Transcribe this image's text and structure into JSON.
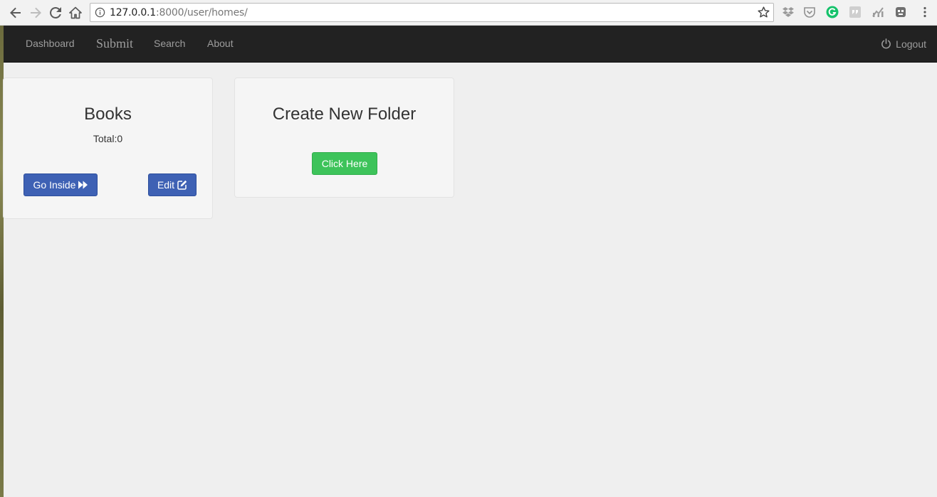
{
  "browser": {
    "url_host": "127.0.0.1",
    "url_rest": ":8000/user/homes/"
  },
  "navbar": {
    "items": [
      {
        "label": "Dashboard"
      },
      {
        "label": "Submit"
      },
      {
        "label": "Search"
      },
      {
        "label": "About"
      }
    ],
    "logout_label": "Logout"
  },
  "folder_card": {
    "title": "Books",
    "total_text": "Total:0",
    "go_inside_label": "Go Inside",
    "edit_label": "Edit"
  },
  "create_card": {
    "title": "Create New Folder",
    "button_label": "Click Here"
  },
  "colors": {
    "navbar_bg": "#222222",
    "primary_button": "#3e61b4",
    "success_button": "#3dc35a",
    "page_bg": "#efefef"
  },
  "icons": [
    "back-arrow-icon",
    "forward-arrow-icon",
    "reload-icon",
    "home-icon",
    "info-icon",
    "star-icon",
    "power-icon",
    "fast-forward-icon",
    "edit-icon"
  ]
}
